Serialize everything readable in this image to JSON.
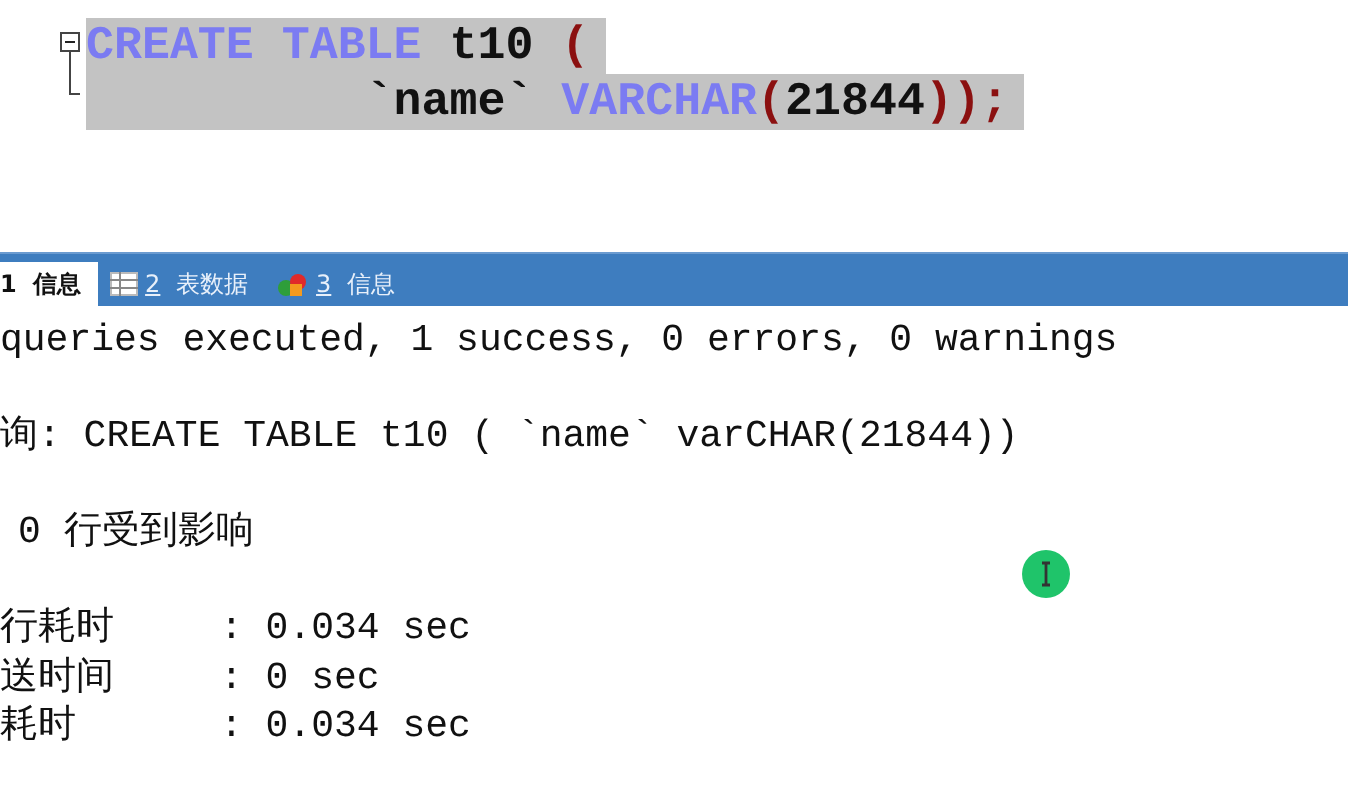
{
  "editor": {
    "lines": [
      {
        "tokens": [
          {
            "kind": "keyword",
            "text": "CREATE TABLE"
          },
          {
            "kind": "plain",
            "text": " t10 "
          },
          {
            "kind": "paren",
            "text": "("
          }
        ]
      },
      {
        "tokens": [
          {
            "kind": "plain",
            "text": "`name` "
          },
          {
            "kind": "keyword",
            "text": "VARCHAR"
          },
          {
            "kind": "paren",
            "text": "("
          },
          {
            "kind": "plain",
            "text": "21844"
          },
          {
            "kind": "paren",
            "text": "));"
          }
        ]
      }
    ]
  },
  "tabs": [
    {
      "number": "1",
      "label": "信息",
      "selected": true
    },
    {
      "number": "2",
      "label": "表数据",
      "selected": false
    },
    {
      "number": "3",
      "label": "信息",
      "selected": false
    }
  ],
  "output": {
    "summary": "queries executed, 1 success, 0 errors, 0 warnings",
    "query": "询: CREATE TABLE t10 ( `name` varCHAR(21844))",
    "affected": "0 行受到影响",
    "timings": [
      {
        "label": "行耗时",
        "value": ": 0.034 sec"
      },
      {
        "label": "送时间",
        "value": ": 0 sec"
      },
      {
        "label": "耗时",
        "value": ": 0.034 sec"
      }
    ]
  }
}
